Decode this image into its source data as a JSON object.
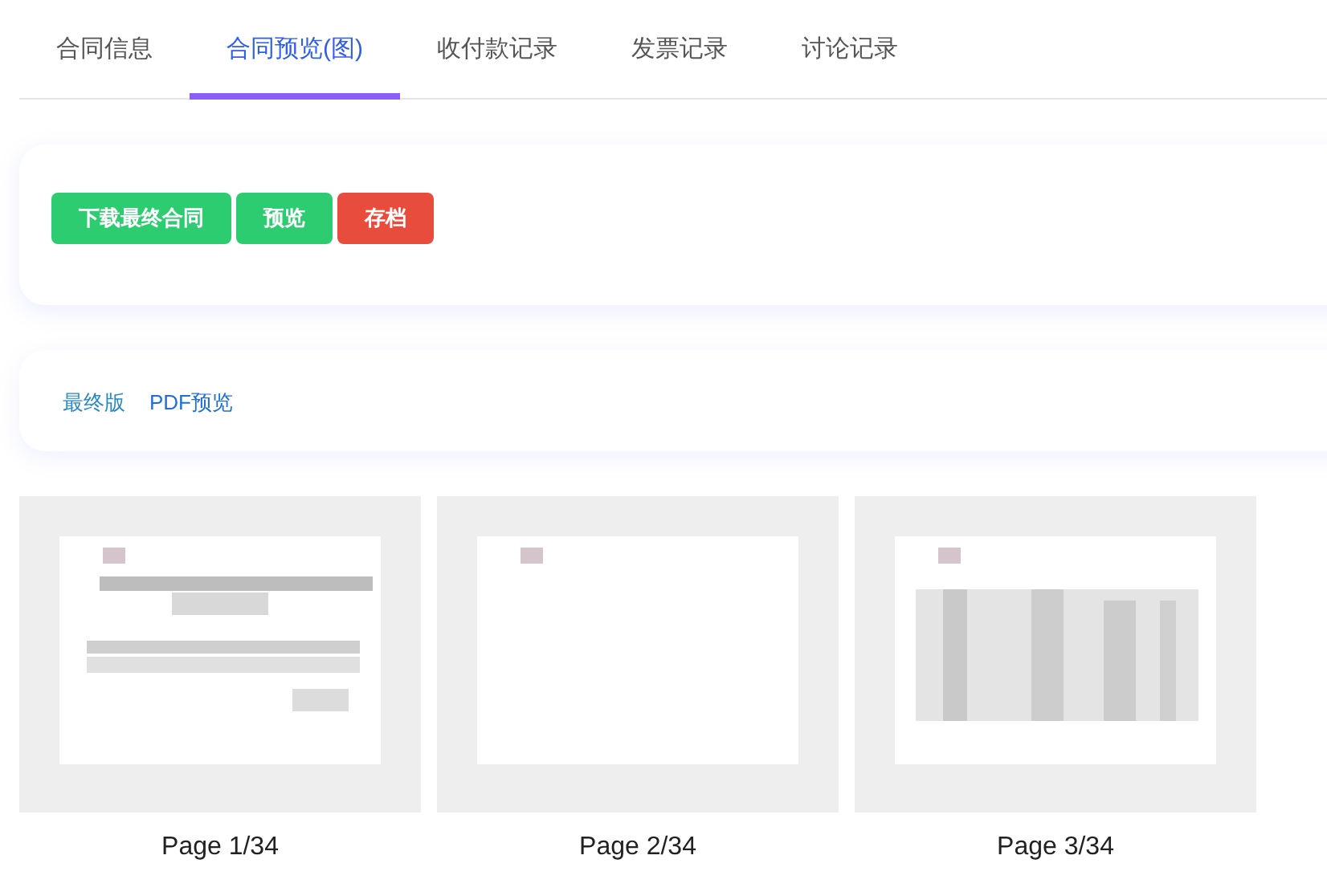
{
  "tabs": [
    {
      "label": "合同信息",
      "selected": false
    },
    {
      "label": "合同预览(图)",
      "selected": true
    },
    {
      "label": "收付款记录",
      "selected": false
    },
    {
      "label": "发票记录",
      "selected": false
    },
    {
      "label": "讨论记录",
      "selected": false
    }
  ],
  "actions": [
    {
      "label": "下载最终合同",
      "kind": "success"
    },
    {
      "label": "预览",
      "kind": "success"
    },
    {
      "label": "存档",
      "kind": "danger"
    }
  ],
  "links": [
    {
      "label": "最终版",
      "color": "#2b8ac0"
    },
    {
      "label": "PDF预览",
      "color": "#1f6fd8"
    }
  ],
  "pages": [
    {
      "kind": "picture",
      "caption": "Page 1/34"
    },
    {
      "kind": "picture",
      "caption": "Page 2/34"
    },
    {
      "kind": "picture",
      "caption": "Page 3/34"
    }
  ]
}
